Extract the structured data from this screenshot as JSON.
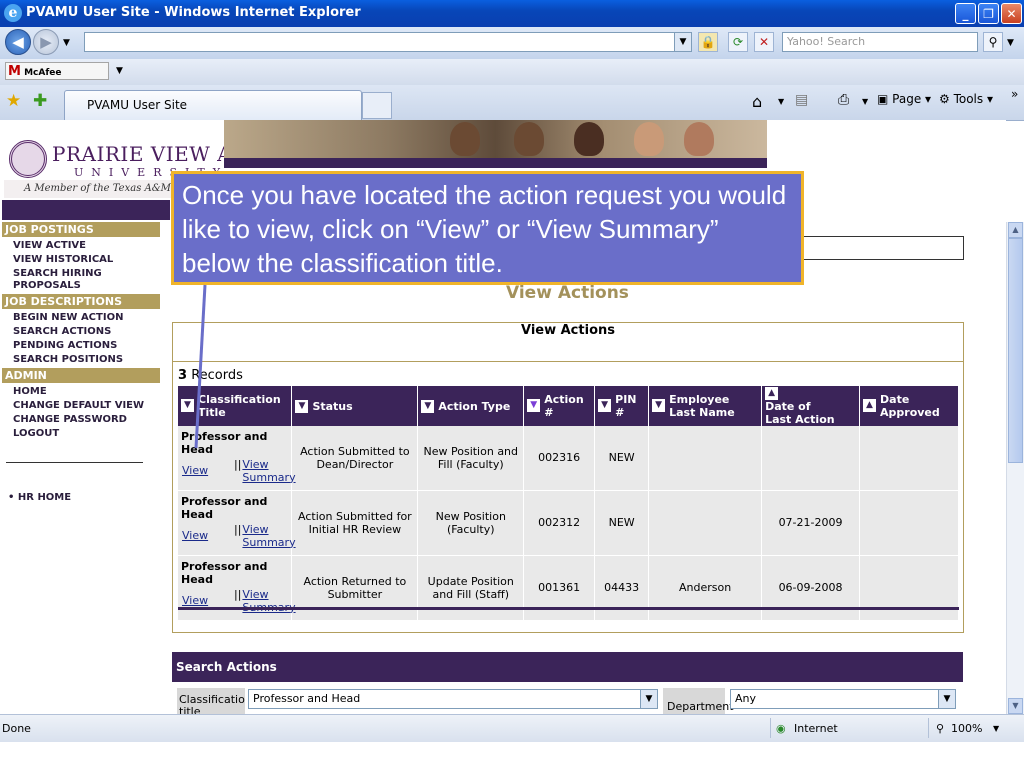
{
  "window": {
    "title": "PVAMU User Site - Windows Internet Explorer",
    "buttons": {
      "minimize": "_",
      "maximize": "❐",
      "close": "✕"
    }
  },
  "addressbar": {
    "url": "",
    "search_placeholder": "Yahoo! Search"
  },
  "links_bar": {
    "mcafee_prefix": "M",
    "mcafee_label": "McAfee SiteAdvisor"
  },
  "tabs": [
    {
      "label": "PVAMU User Site"
    }
  ],
  "command_bar": {
    "page": "Page",
    "tools": "Tools"
  },
  "banner": {
    "university": "PRAIRIE VIEW A&M",
    "sub": "UNIVERSITY",
    "member": "A Member of the Texas A&M Uni"
  },
  "leftnav": {
    "sections": [
      {
        "header": "JOB POSTINGS",
        "items": [
          "VIEW ACTIVE",
          "VIEW HISTORICAL",
          "SEARCH HIRING PROPOSALS"
        ]
      },
      {
        "header": "JOB DESCRIPTIONS",
        "items": [
          "BEGIN NEW ACTION",
          "SEARCH ACTIONS",
          "PENDING ACTIONS",
          "SEARCH POSITIONS"
        ]
      },
      {
        "header": "ADMIN",
        "items": [
          "HOME",
          "CHANGE DEFAULT VIEW",
          "CHANGE PASSWORD",
          "LOGOUT"
        ]
      }
    ],
    "hr_home": "HR HOME"
  },
  "content": {
    "page_heading": "View Actions",
    "panel_title": "View Actions",
    "record_count": "3",
    "record_label": "Records",
    "columns": [
      {
        "label": "Classification Title",
        "sort": "▼"
      },
      {
        "label": "Status",
        "sort": "▼"
      },
      {
        "label": "Action Type",
        "sort": "▼"
      },
      {
        "label": "Action #",
        "sort": "▼"
      },
      {
        "label": "PIN #",
        "sort": "▼"
      },
      {
        "label": "Employee Last Name",
        "sort": "▼"
      },
      {
        "label": "Date of Last Action",
        "sort": "▲"
      },
      {
        "label": "Date Approved",
        "sort": "▲"
      }
    ],
    "rows": [
      {
        "title": "Professor and Head",
        "view": "View",
        "bars": "||",
        "summary": "View Summary",
        "status": "Action Submitted to Dean/Director",
        "action_type": "New Position and Fill (Faculty)",
        "action_no": "002316",
        "pin": "NEW",
        "last_name": "",
        "last_action": "",
        "approved": ""
      },
      {
        "title": "Professor and Head",
        "view": "View",
        "bars": "||",
        "summary": "View Summary",
        "status": "Action Submitted for Initial HR Review",
        "action_type": "New Position (Faculty)",
        "action_no": "002312",
        "pin": "NEW",
        "last_name": "",
        "last_action": "07-21-2009",
        "approved": ""
      },
      {
        "title": "Professor and Head",
        "view": "View",
        "bars": "||",
        "summary": "View Summary",
        "status": "Action Returned to Submitter",
        "action_type": "Update Position and Fill (Staff)",
        "action_no": "001361",
        "pin": "04433",
        "last_name": "Anderson",
        "last_action": "06-09-2008",
        "approved": ""
      }
    ]
  },
  "search_actions": {
    "header": "Search Actions",
    "classification_label": "Classification title",
    "classification_value": "Professor and Head",
    "department_label": "Department",
    "department_value": "Any"
  },
  "callout": {
    "text": "Once you have located the action request you would like to view, click on “View” or “View Summary” below the classification title."
  },
  "statusbar": {
    "status": "Done",
    "zone": "Internet",
    "zoom": "100%"
  },
  "colors": {
    "purple": "#3b2459",
    "gold": "#b29e5d",
    "callout_bg": "#6a6ec9",
    "callout_border": "#f0b42a"
  }
}
